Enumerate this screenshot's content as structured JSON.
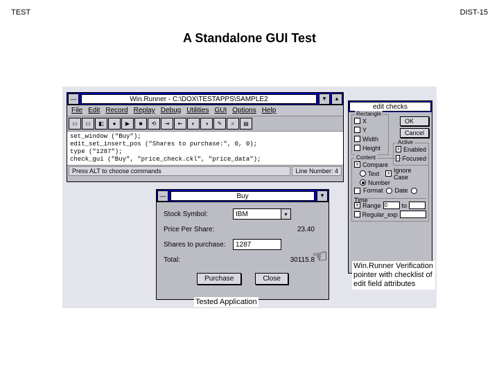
{
  "page": {
    "header_left": "TEST",
    "header_right": "DIST-15",
    "title": "A Standalone GUI Test"
  },
  "winrunner": {
    "title": "Win.Runner - C:\\DOX\\TESTAPPS\\SAMPLE2",
    "menu": [
      "File",
      "Edit",
      "Record",
      "Replay",
      "Debug",
      "Utilities",
      "GUI",
      "Options",
      "Help"
    ],
    "code_lines": [
      "set_window (\"Buy\");",
      "edit_set_insert_pos (\"Shares to purchase:\", 0, 0);",
      "type (\"1287\");",
      "check_gui (\"Buy\", \"price_check.ckl\", \"price_data\");"
    ],
    "status_left": "Press ALT to choose commands",
    "status_right": "Line Number: 4"
  },
  "buy": {
    "title": "Buy",
    "fields": {
      "symbol_label": "Stock Symbol:",
      "symbol_value": "IBM",
      "price_label": "Price Per Share:",
      "price_value": "23.40",
      "shares_label": "Shares to purchase:",
      "shares_value": "1287",
      "total_label": "Total:",
      "total_value": "30115.8"
    },
    "purchase": "Purchase",
    "close": "Close"
  },
  "editchecks": {
    "title": "edit checks",
    "ok": "OK",
    "cancel": "Cancel",
    "groups": {
      "rectangle": "Rectangle",
      "active": "Active",
      "content": "Content"
    },
    "rect": {
      "x": "X",
      "y": "Y",
      "w": "Width",
      "h": "Height"
    },
    "active": {
      "enabled": "Enabled",
      "focused": "Focused"
    },
    "content": {
      "compare": "Compare",
      "text": "Text",
      "ignore": "Ignore Case",
      "number": "Number",
      "format": "Format",
      "date": "Date",
      "time": "Time",
      "range": "Range",
      "range_lo": "0",
      "range_hi": "to",
      "regex": "Regular_exp"
    }
  },
  "captions": {
    "tested": "Tested Application",
    "right": "Win.Runner Verification pointer with checklist of edit field attributes"
  }
}
